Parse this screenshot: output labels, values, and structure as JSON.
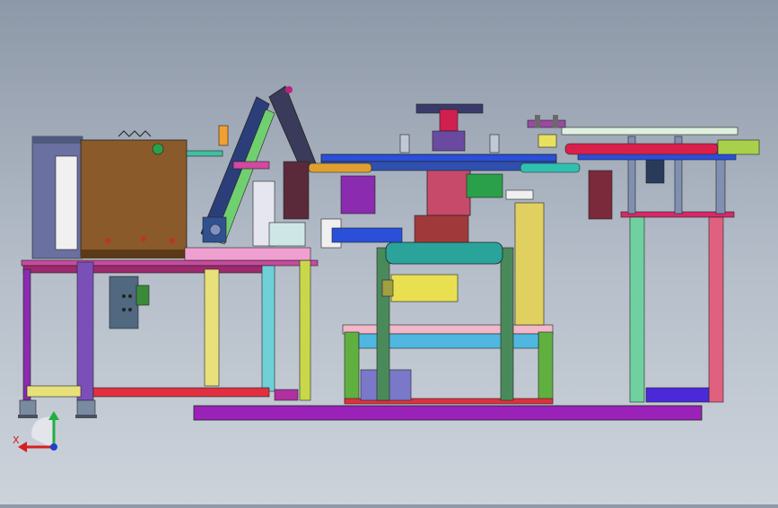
{
  "viewport": {
    "background_top": "#8d98a8",
    "background_bottom": "#cdd3db"
  },
  "model": {
    "view": "front",
    "description_colors": {
      "frame_magenta": "#c0288a",
      "frame_purple": "#8a2bb0",
      "frame_green": "#5fc46a",
      "frame_yellow": "#e8e07a",
      "frame_cyan": "#57c7d6",
      "table_blue": "#2a4fd8",
      "base_purple": "#9a22b8",
      "cabinet_brown": "#8a5a2a",
      "cylinder_teal": "#2aa39a",
      "cylinder_red": "#d8204a"
    }
  },
  "triad": {
    "x_label": "X",
    "x_color": "#d42020",
    "y_color": "#20b040",
    "z_color": "#2040d0"
  }
}
